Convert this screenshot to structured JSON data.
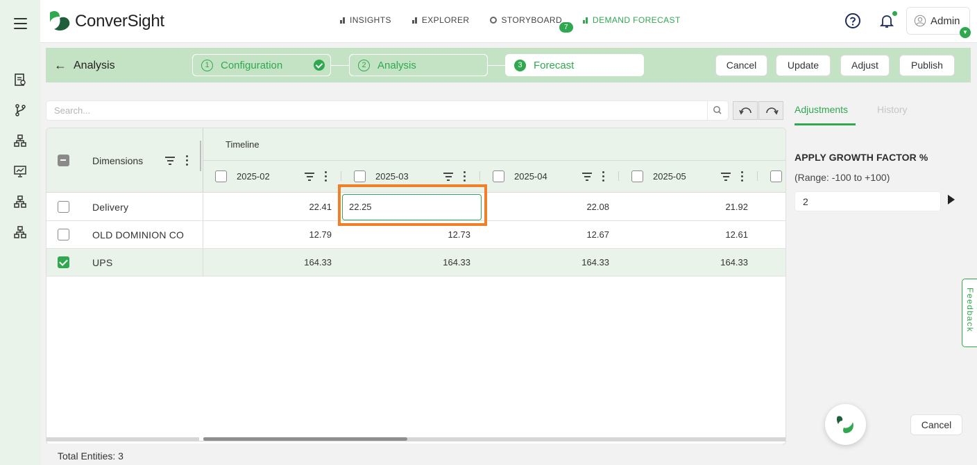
{
  "app": {
    "brand": "ConverSight"
  },
  "nav": {
    "items": [
      {
        "label": "INSIGHTS",
        "icon": "bar-chart-icon"
      },
      {
        "label": "EXPLORER",
        "icon": "bar-chart-icon"
      },
      {
        "label": "STORYBOARD",
        "icon": "storyboard-icon",
        "badge": "7"
      },
      {
        "label": "DEMAND FORECAST",
        "icon": "bar-chart-icon",
        "active": true
      }
    ]
  },
  "user": {
    "name": "Admin"
  },
  "sidebar": {
    "icons": [
      "menu-icon",
      "report-icon",
      "branch-icon",
      "hierarchy-icon",
      "presentation-icon",
      "hierarchy-icon",
      "hierarchy-icon"
    ]
  },
  "stepbar": {
    "back_label": "Analysis",
    "steps": [
      {
        "num": "1",
        "label": "Configuration",
        "done": true
      },
      {
        "num": "2",
        "label": "Analysis"
      },
      {
        "num": "3",
        "label": "Forecast",
        "current": true
      }
    ],
    "actions": {
      "cancel": "Cancel",
      "update": "Update",
      "adjust": "Adjust",
      "publish": "Publish"
    }
  },
  "search": {
    "placeholder": "Search..."
  },
  "grid": {
    "dim_header": "Dimensions",
    "timeline_header": "Timeline",
    "columns": [
      "2025-02",
      "2025-03",
      "2025-04",
      "2025-05"
    ],
    "rows": [
      {
        "name": "Delivery",
        "values": [
          "22.41",
          "22.25",
          "22.08",
          "21.92"
        ],
        "checked": false
      },
      {
        "name": "OLD DOMINION CO",
        "values": [
          "12.79",
          "12.73",
          "12.67",
          "12.61"
        ],
        "checked": false
      },
      {
        "name": "UPS",
        "values": [
          "164.33",
          "164.33",
          "164.33",
          "164.33"
        ],
        "checked": true
      }
    ],
    "editing_value": "22.25",
    "footer": "Total Entities: 3"
  },
  "panel": {
    "tabs": [
      "Adjustments",
      "History"
    ],
    "title": "APPLY GROWTH FACTOR %",
    "range": "(Range: -100 to +100)",
    "value": "2"
  },
  "feedback": "Feedback",
  "bottom": {
    "cancel": "Cancel"
  },
  "colors": {
    "accent": "#2fa84f",
    "highlight": "#f07f2a",
    "header_bg": "#e9f3e9",
    "stepbar_bg": "#c4e3c4"
  }
}
